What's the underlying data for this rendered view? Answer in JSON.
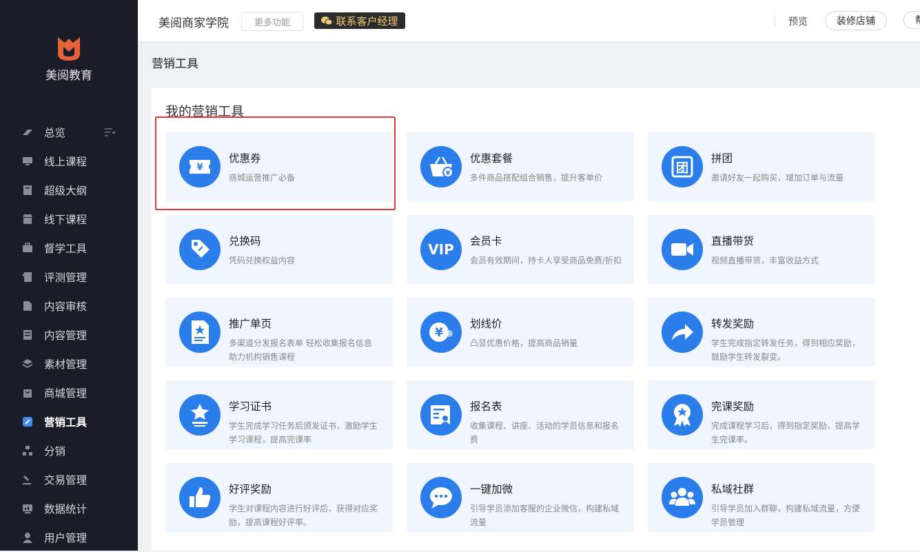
{
  "brand": {
    "name": "美阅教育"
  },
  "sidebar": {
    "items": [
      {
        "label": "总览",
        "icon": "dashboard-icon",
        "has_filter": true
      },
      {
        "label": "线上课程",
        "icon": "monitor-icon"
      },
      {
        "label": "超级大纲",
        "icon": "outline-book-icon"
      },
      {
        "label": "线下课程",
        "icon": "store-icon"
      },
      {
        "label": "督学工具",
        "icon": "briefcase-icon"
      },
      {
        "label": "评测管理",
        "icon": "exam-icon"
      },
      {
        "label": "内容审核",
        "icon": "document-icon"
      },
      {
        "label": "内容管理",
        "icon": "content-icon"
      },
      {
        "label": "素材管理",
        "icon": "layers-icon"
      },
      {
        "label": "商城管理",
        "icon": "shop-bag-icon"
      },
      {
        "label": "营销工具",
        "icon": "marketing-tag-icon",
        "active": true
      },
      {
        "label": "分销",
        "icon": "distribution-icon"
      },
      {
        "label": "交易管理",
        "icon": "gavel-icon"
      },
      {
        "label": "数据统计",
        "icon": "chart-monitor-icon"
      },
      {
        "label": "用户管理",
        "icon": "user-icon"
      }
    ]
  },
  "topbar": {
    "title": "美阅商家学院",
    "more_label": "更多功能",
    "contact_label": "联系客户经理",
    "preview_label": "预览",
    "decorate_label": "装修店铺",
    "help_label": "帮"
  },
  "page": {
    "title": "营销工具",
    "section_title": "我的营销工具"
  },
  "tools": [
    {
      "title": "优惠券",
      "desc": "商城运营推广必备",
      "icon": "coupon-icon"
    },
    {
      "title": "优惠套餐",
      "desc": "多件商品搭配组合销售，提升客单价",
      "icon": "basket-icon"
    },
    {
      "title": "拼团",
      "desc": "邀请好友一起购买，增加订单与流量",
      "icon": "group-buy-icon"
    },
    {
      "title": "兑换码",
      "desc": "凭码兑换权益内容",
      "icon": "redeem-tag-icon"
    },
    {
      "title": "会员卡",
      "desc": "会员有效期间，持卡人享受商品免费/折扣",
      "icon": "vip-icon"
    },
    {
      "title": "直播带货",
      "desc": "视频直播带货，丰富收益方式",
      "icon": "video-camera-icon"
    },
    {
      "title": "推广单页",
      "desc": "多渠道分发报名表单 轻松收集报名信息 助力机构销售课程",
      "icon": "promo-page-icon"
    },
    {
      "title": "划线价",
      "desc": "凸显优惠价格，提高商品销量",
      "icon": "yuan-price-icon"
    },
    {
      "title": "转发奖励",
      "desc": "学生完成指定转发任务，得到相应奖励，鼓励学生转发裂变。",
      "icon": "share-arrow-icon"
    },
    {
      "title": "学习证书",
      "desc": "学生完成学习任务后颁发证书，激励学生学习课程，提高完课率",
      "icon": "certificate-icon"
    },
    {
      "title": "报名表",
      "desc": "收集课程、讲座、活动的学员信息和报名费",
      "icon": "signup-form-icon"
    },
    {
      "title": "完课奖励",
      "desc": "完成课程学习后，得到指定奖励，提高学生完课率。",
      "icon": "medal-icon"
    },
    {
      "title": "好评奖励",
      "desc": "学生对课程内容进行好评后，获得对应奖励，提高课程好评率。",
      "icon": "thumbs-up-icon"
    },
    {
      "title": "一键加微",
      "desc": "引导学员添加客服的企业微信，构建私域流量",
      "icon": "chat-bubble-icon"
    },
    {
      "title": "私域社群",
      "desc": "引导学员加入群聊，构建私域流量，方便学员管理",
      "icon": "community-icon"
    }
  ],
  "colors": {
    "sidebar_bg": "#1b1c28",
    "accent": "#2b7de9",
    "card_bg": "#f0f6ff",
    "highlight_border": "#e53935",
    "contact_text": "#f0c976"
  }
}
